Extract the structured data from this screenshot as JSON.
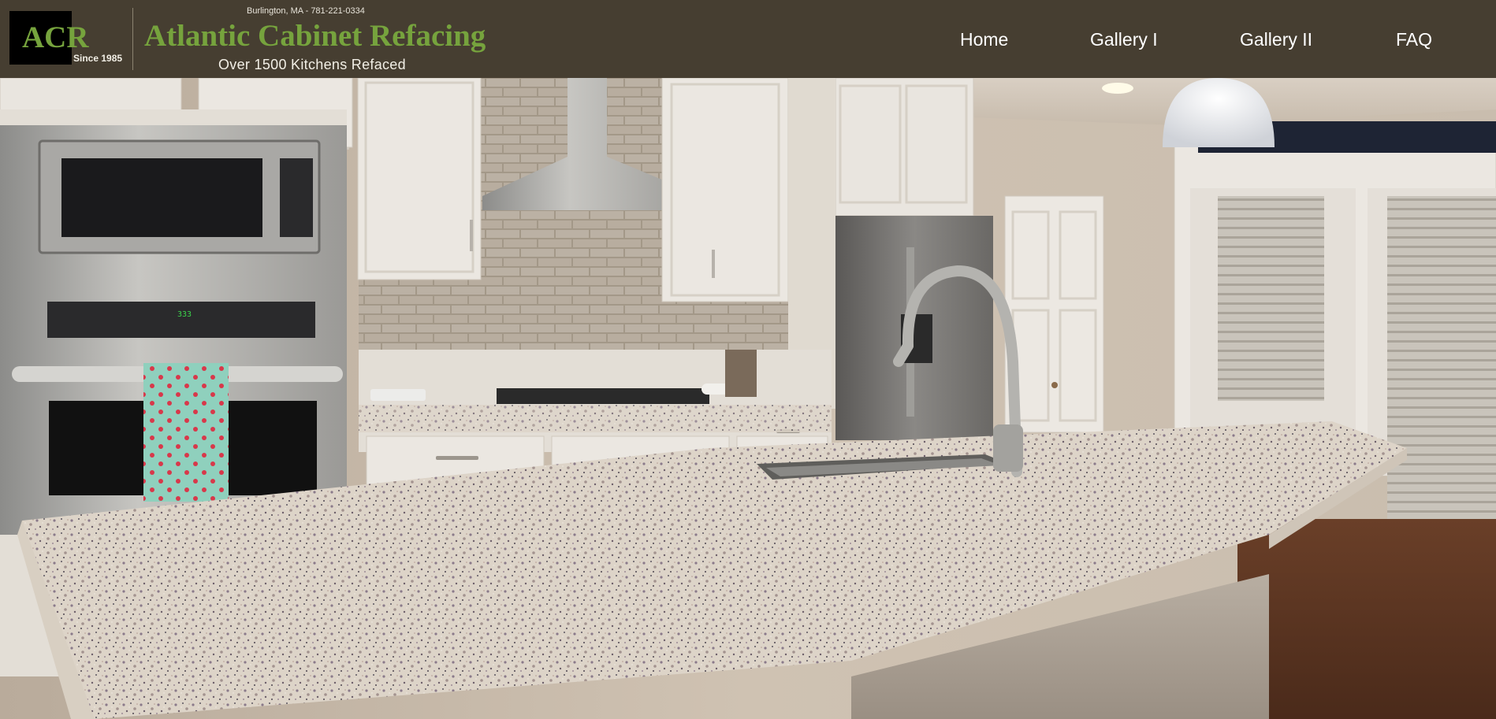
{
  "header": {
    "logo": {
      "abbr": "ACR",
      "since": "Since 1985"
    },
    "contact": "Burlington, MA - 781-221-0334",
    "brand_name": "Atlantic Cabinet Refacing",
    "tagline": "Over 1500 Kitchens Refaced"
  },
  "nav": {
    "items": [
      {
        "label": "Home"
      },
      {
        "label": "Gallery I"
      },
      {
        "label": "Gallery II"
      },
      {
        "label": "FAQ"
      }
    ]
  },
  "hero": {
    "image_alt": "kitchen-photo",
    "oven_display": "333"
  },
  "colors": {
    "header_bg": "#463e31",
    "brand_green": "#76a33d",
    "nav_text": "#ffffff"
  }
}
